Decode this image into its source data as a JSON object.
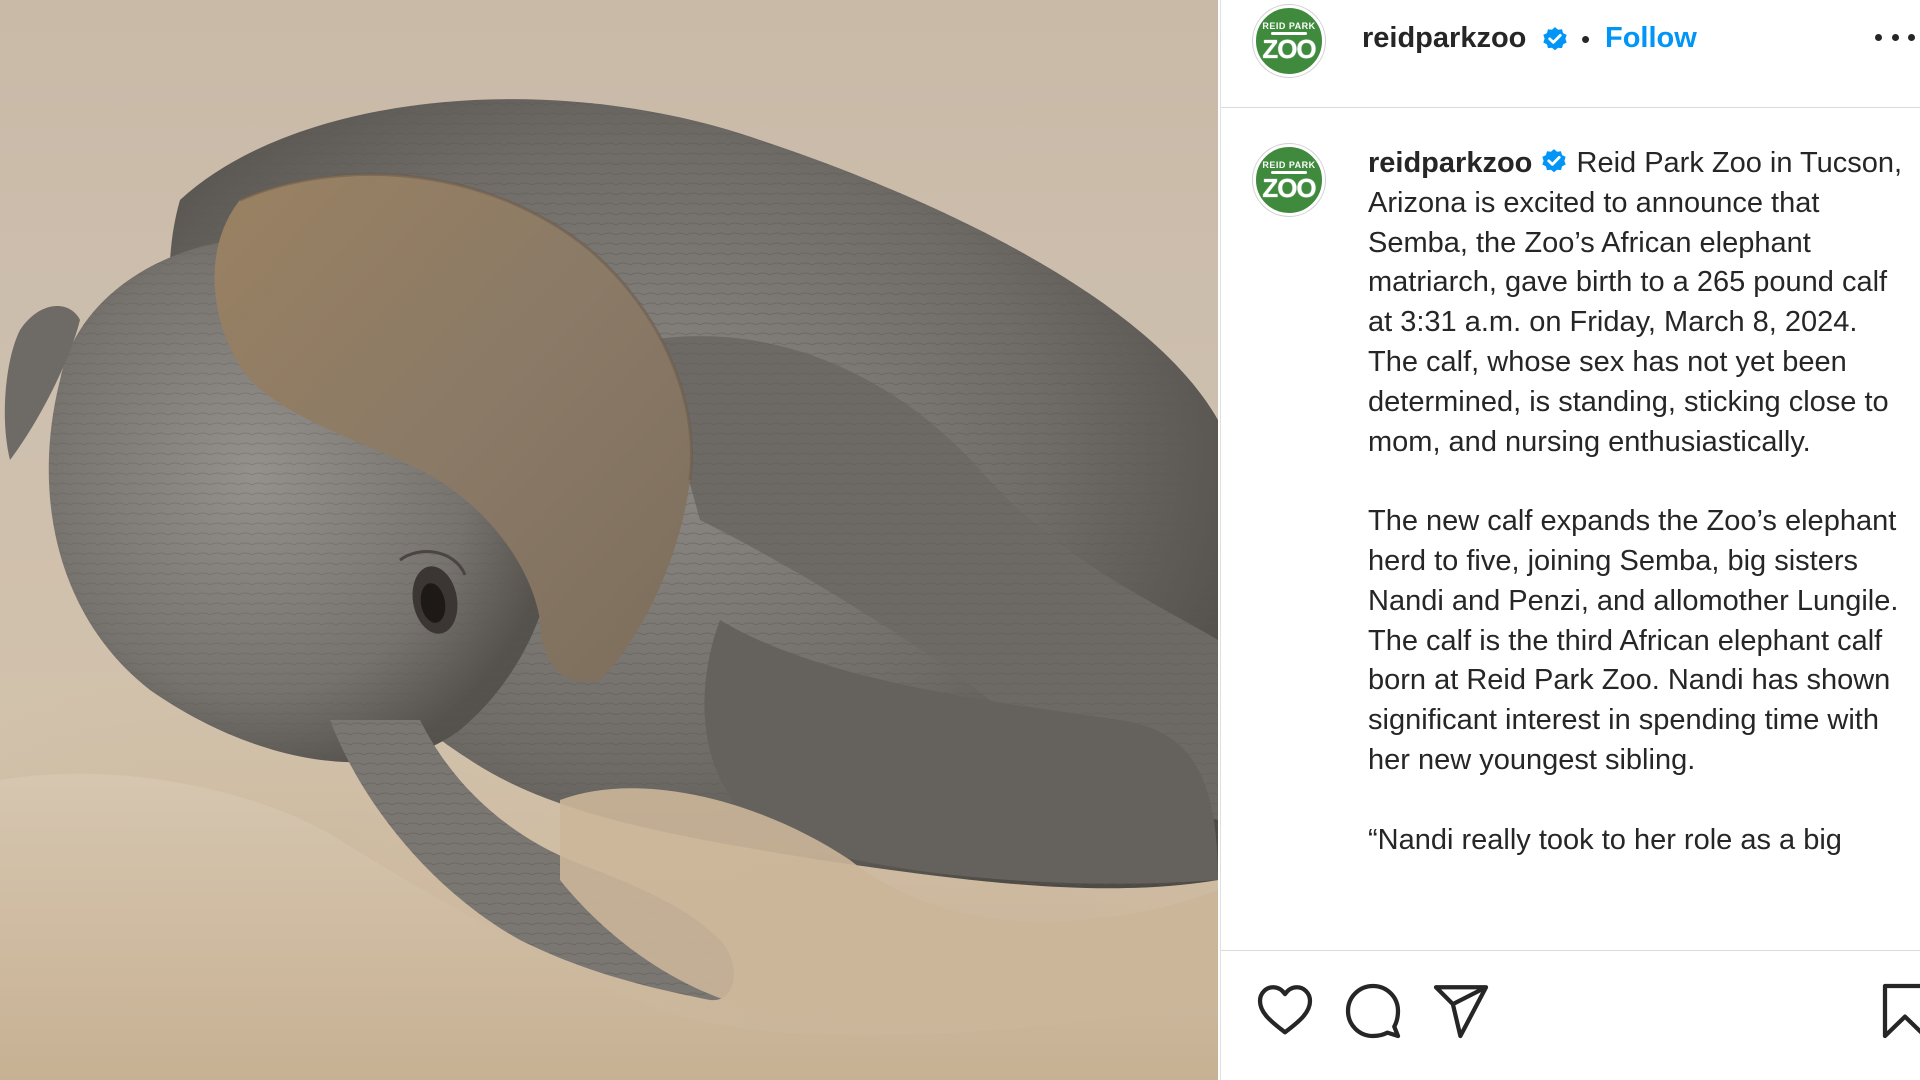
{
  "post": {
    "username": "reidparkzoo",
    "avatar_text_top": "REID PARK",
    "avatar_text_main": "ZOO",
    "separator": "•",
    "follow_label": "Follow",
    "caption_paragraphs": [
      "Reid Park Zoo in Tucson, Arizona is excited to announce that Semba, the Zoo’s African elephant matriarch, gave birth to a 265 pound calf at 3:31 a.m. on Friday, March 8, 2024. The calf, whose sex has not yet been determined, is standing, sticking close to mom, and nursing enthusiastically.",
      "The new calf expands the Zoo’s elephant herd to five, joining Semba, big sisters Nandi and Penzi, and allomother Lungile. The calf is the third African elephant calf born at Reid Park Zoo. Nandi has shown significant interest in spending time with her new youngest sibling.",
      "“Nandi really took to her role as a big"
    ]
  },
  "icons": {
    "verified": "verified-badge-icon",
    "more": "more-options-icon",
    "like": "heart-icon",
    "comment": "comment-icon",
    "share": "share-icon",
    "save": "bookmark-icon"
  },
  "colors": {
    "accent": "#0095f6",
    "verified": "#0095f6",
    "avatar_green": "#3f8a3c",
    "text": "#262626"
  }
}
